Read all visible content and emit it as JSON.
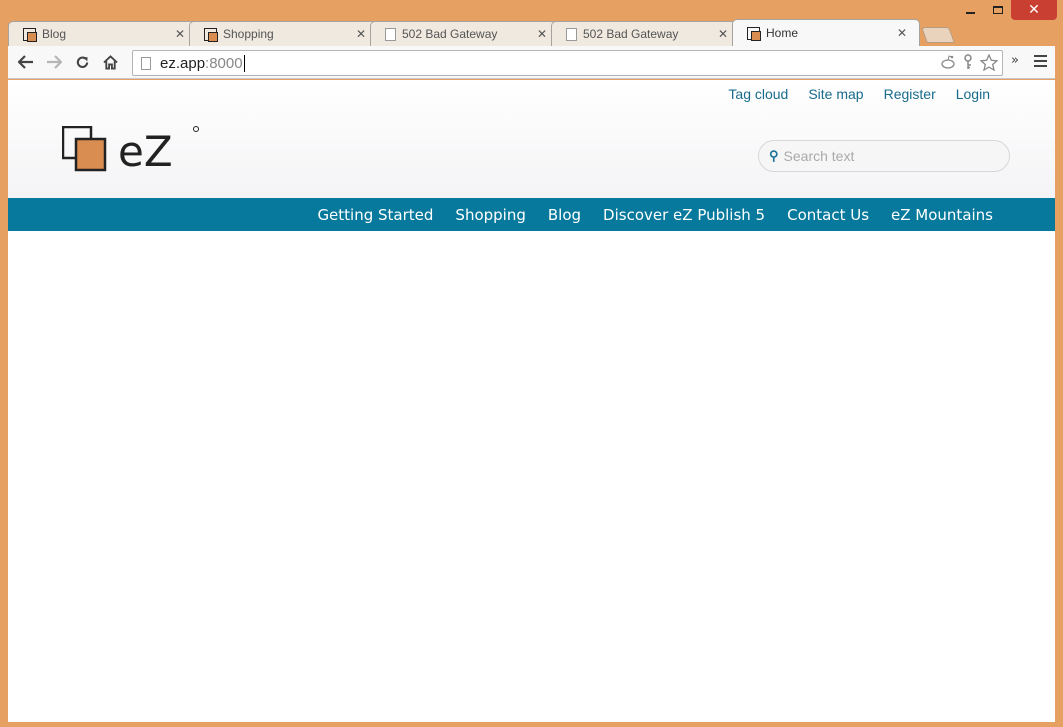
{
  "window": {
    "minimize_label": "minimize",
    "maximize_label": "maximize",
    "close_label": "✕"
  },
  "tabs": [
    {
      "title": "Blog",
      "favicon": "ez-icon"
    },
    {
      "title": "Shopping",
      "favicon": "ez-icon"
    },
    {
      "title": "502 Bad Gateway",
      "favicon": "page-icon"
    },
    {
      "title": "502 Bad Gateway",
      "favicon": "page-icon"
    },
    {
      "title": "Home",
      "favicon": "ez-icon",
      "active": true
    }
  ],
  "tab_close": "✕",
  "toolbar": {
    "url_host": "ez.app",
    "url_port": ":8000"
  },
  "site": {
    "util_links": [
      "Tag cloud",
      "Site map",
      "Register",
      "Login"
    ],
    "search_placeholder": "Search text",
    "nav": [
      "Getting Started",
      "Shopping",
      "Blog",
      "Discover eZ Publish 5",
      "Contact Us",
      "eZ Mountains"
    ],
    "logo_text": "eZ",
    "brand_color": "#07799c",
    "accent_color": "#d98d50"
  }
}
